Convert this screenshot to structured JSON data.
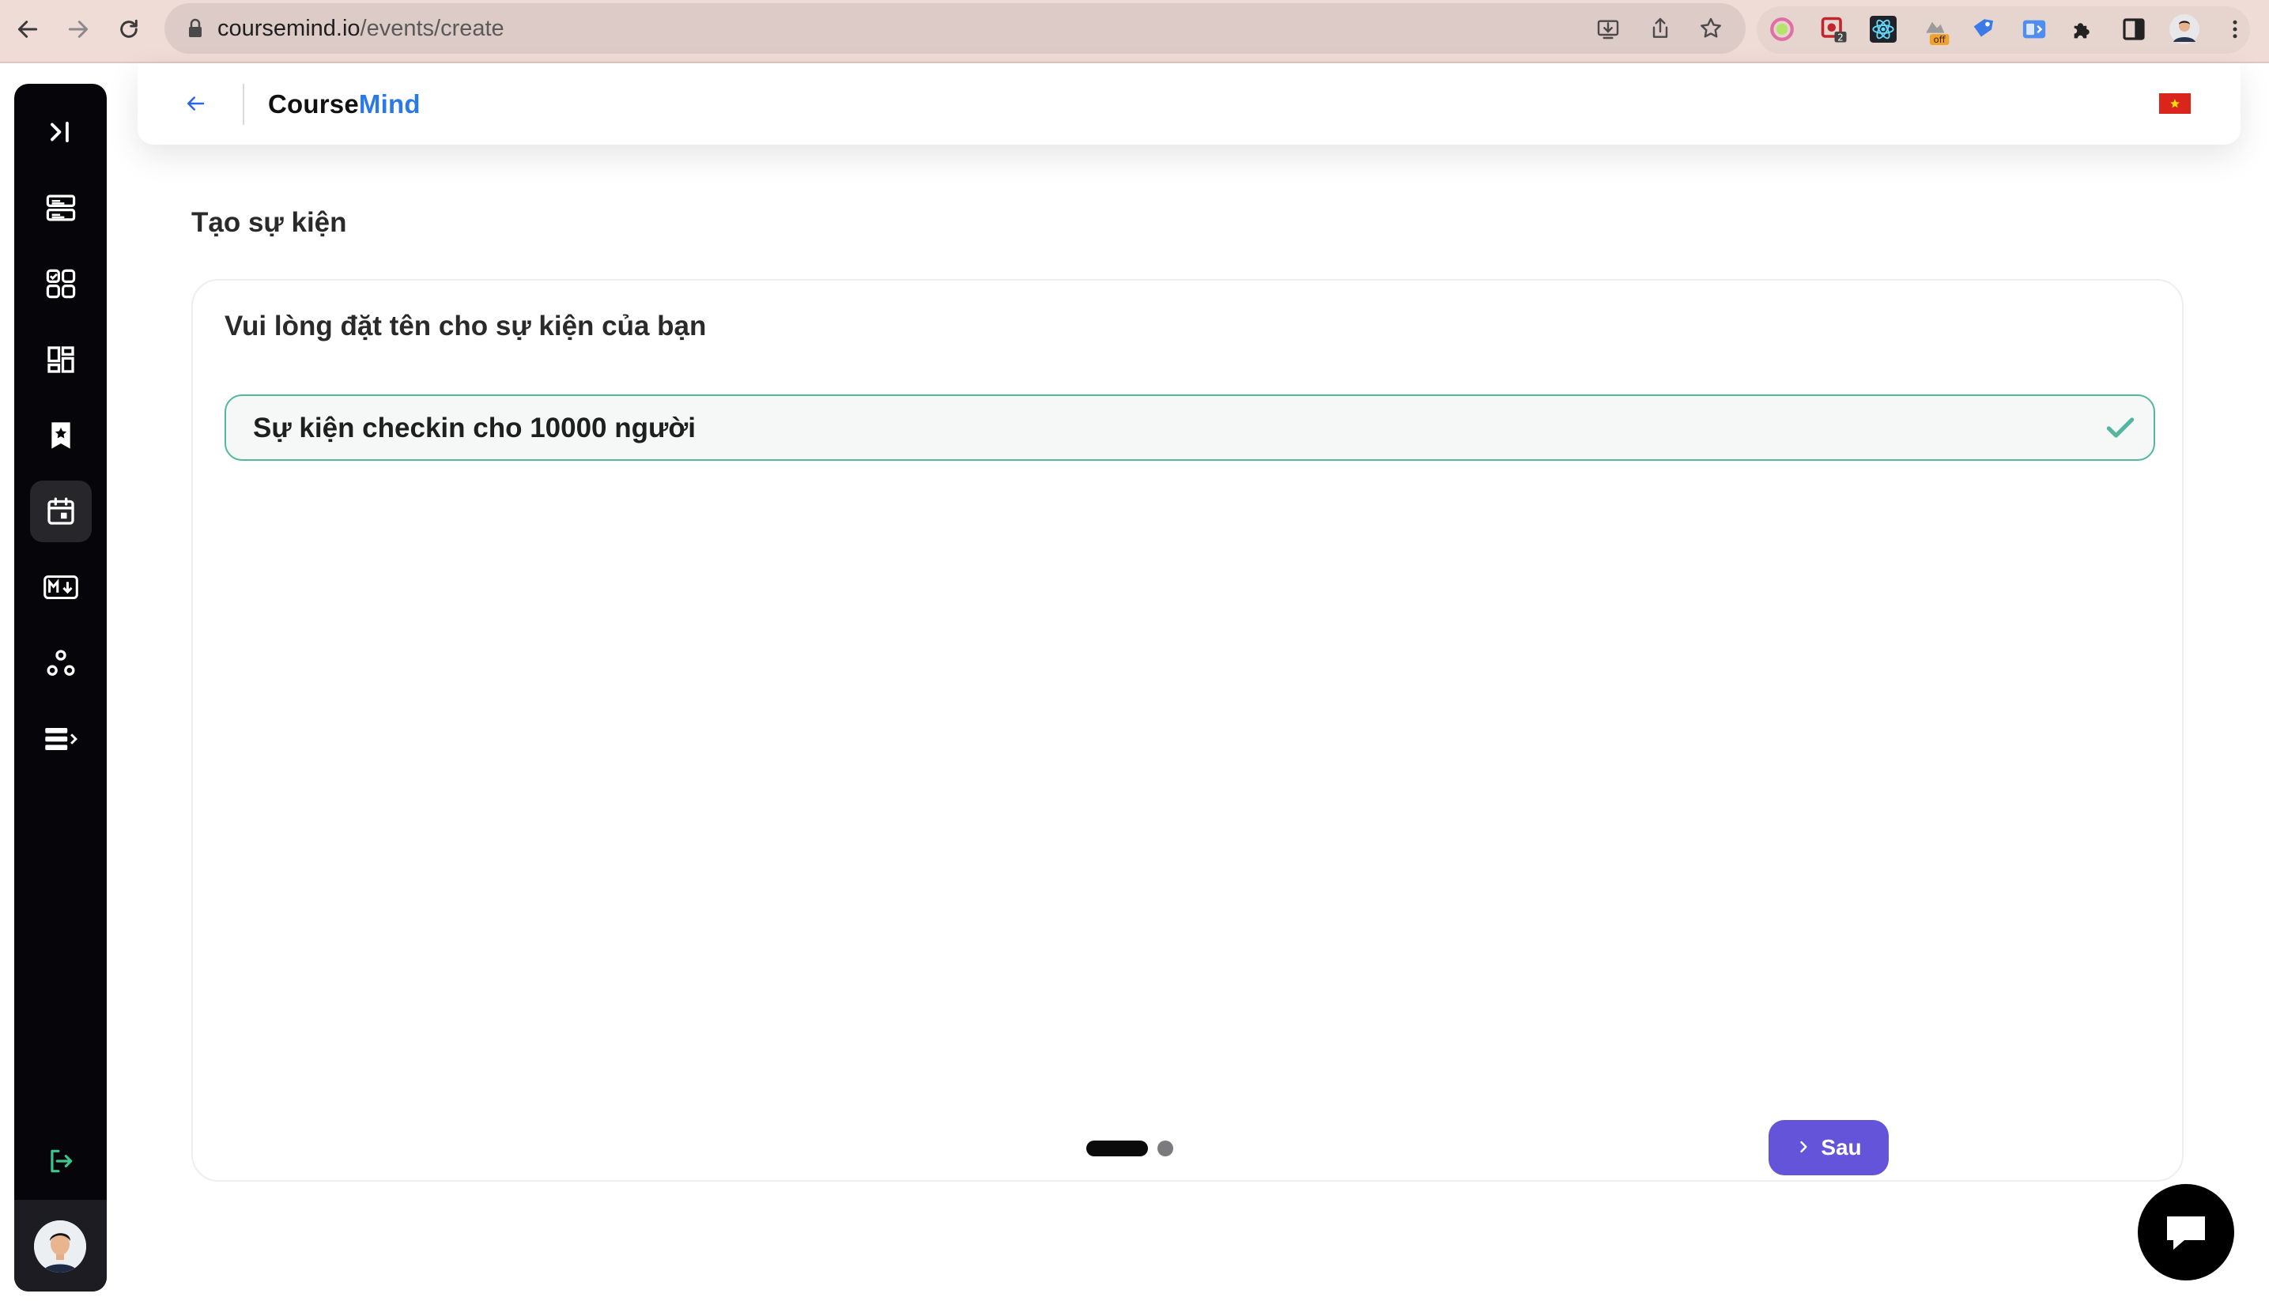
{
  "browser": {
    "url_host": "coursemind.io",
    "url_path": "/events/create",
    "extensions": [
      "color-picker-icon",
      "screen-recorder-icon",
      "react-devtools-icon",
      "extension-off-icon",
      "tag-icon",
      "sidebar-extension-icon",
      "puzzle-icon",
      "side-panel-icon"
    ],
    "badges": {
      "recorder": "2",
      "off": "off"
    }
  },
  "sidebar": {
    "items": [
      {
        "name": "toggle",
        "icon": "expand-sidebar-icon"
      },
      {
        "name": "dashboard",
        "icon": "server-icon"
      },
      {
        "name": "apps",
        "icon": "apps-check-icon"
      },
      {
        "name": "widgets",
        "icon": "dashboard-icon"
      },
      {
        "name": "bookmarks",
        "icon": "bookmark-star-icon"
      },
      {
        "name": "events",
        "icon": "calendar-icon",
        "active": true
      },
      {
        "name": "markdown",
        "icon": "markdown-icon"
      },
      {
        "name": "groups",
        "icon": "nodes-icon"
      },
      {
        "name": "lists",
        "icon": "list-arrow-icon"
      }
    ],
    "logout_icon": "logout-icon"
  },
  "header": {
    "brand_part1": "Course",
    "brand_part2": "Mind",
    "brand_color": "#2b78e8",
    "language_flag": "vietnam-flag-icon"
  },
  "page": {
    "title": "Tạo sự kiện",
    "question": "Vui lòng đặt tên cho sự kiện của bạn",
    "event_name_value": "Sự kiện checkin cho 10000 người",
    "input_border_color": "#52b79e",
    "step_current": 1,
    "step_total": 2,
    "next_label": "Sau",
    "next_color": "#6354d9"
  }
}
